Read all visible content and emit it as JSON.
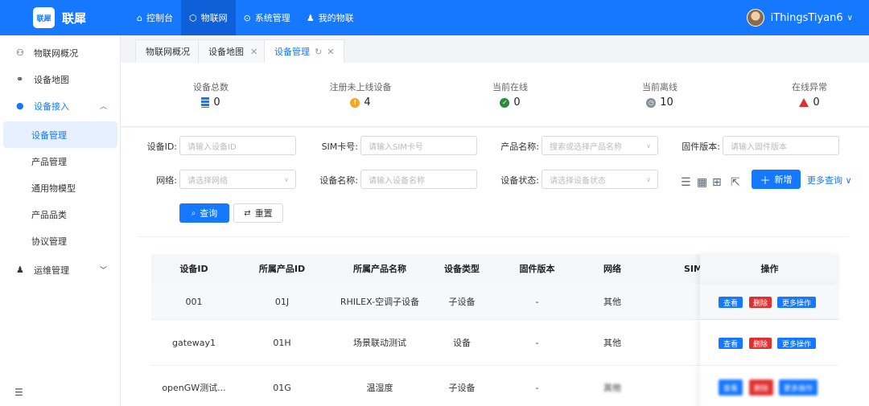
{
  "app": {
    "logo_text": "联犀",
    "brand": "联犀"
  },
  "nav": [
    {
      "label": "控制台",
      "icon": "home-icon"
    },
    {
      "label": "物联网",
      "icon": "cube-icon"
    },
    {
      "label": "系统管理",
      "icon": "gear-circle-icon"
    },
    {
      "label": "我的物联",
      "icon": "users-icon"
    }
  ],
  "user": {
    "name": "iThingsTiyan6"
  },
  "sidebar": {
    "items": [
      {
        "label": "物联网概况"
      },
      {
        "label": "设备地图"
      },
      {
        "label": "设备接入"
      },
      {
        "label": "运维管理"
      }
    ],
    "sub_items": [
      {
        "label": "设备管理"
      },
      {
        "label": "产品管理"
      },
      {
        "label": "通用物模型"
      },
      {
        "label": "产品品类"
      },
      {
        "label": "协议管理"
      }
    ]
  },
  "tabs": [
    {
      "label": "物联网概况"
    },
    {
      "label": "设备地图"
    },
    {
      "label": "设备管理"
    }
  ],
  "stats": [
    {
      "label": "设备总数",
      "value": "0",
      "icon": "database-icon",
      "color": "#1677ff"
    },
    {
      "label": "注册未上线设备",
      "value": "4",
      "icon": "warning-circle-icon",
      "color": "#f5a623"
    },
    {
      "label": "当前在线",
      "value": "0",
      "icon": "check-circle-icon",
      "color": "#2b8a3e"
    },
    {
      "label": "当前离线",
      "value": "10",
      "icon": "clock-icon",
      "color": "#868e96"
    },
    {
      "label": "在线异常",
      "value": "0",
      "icon": "alert-triangle-icon",
      "color": "#e03131"
    }
  ],
  "filters": {
    "device_id": {
      "label": "设备ID:",
      "placeholder": "请输入设备ID"
    },
    "sim": {
      "label": "SIM卡号:",
      "placeholder": "请输入SIM卡号"
    },
    "product_name": {
      "label": "产品名称:",
      "placeholder": "搜索或选择产品名称"
    },
    "firmware": {
      "label": "固件版本:",
      "placeholder": "请输入固件版本"
    },
    "network": {
      "label": "网络:",
      "placeholder": "请选择网络"
    },
    "device_name": {
      "label": "设备名称:",
      "placeholder": "请输入设备名称"
    },
    "device_status": {
      "label": "设备状态:",
      "placeholder": "请选择设备状态"
    }
  },
  "buttons": {
    "query": "查询",
    "reset": "重置",
    "add": "新增",
    "more_query": "更多查询"
  },
  "table": {
    "columns": [
      "设备ID",
      "所属产品ID",
      "所属产品名称",
      "设备类型",
      "固件版本",
      "网络",
      "SIM",
      "操作"
    ],
    "rows": [
      {
        "id": "001",
        "product_id": "01J",
        "product_name": "RHILEX-空调子设备",
        "type": "子设备",
        "firmware": "-",
        "network": "其他"
      },
      {
        "id": "gateway1",
        "product_id": "01H",
        "product_name": "场景联动测试",
        "type": "设备",
        "firmware": "-",
        "network": "其他"
      },
      {
        "id": "openGW测试...",
        "product_id": "01G",
        "product_name": "温湿度",
        "type": "子设备",
        "firmware": "-",
        "network": "其他"
      }
    ],
    "ops": {
      "view": "查看",
      "delete": "删除",
      "more": "更多操作"
    }
  }
}
